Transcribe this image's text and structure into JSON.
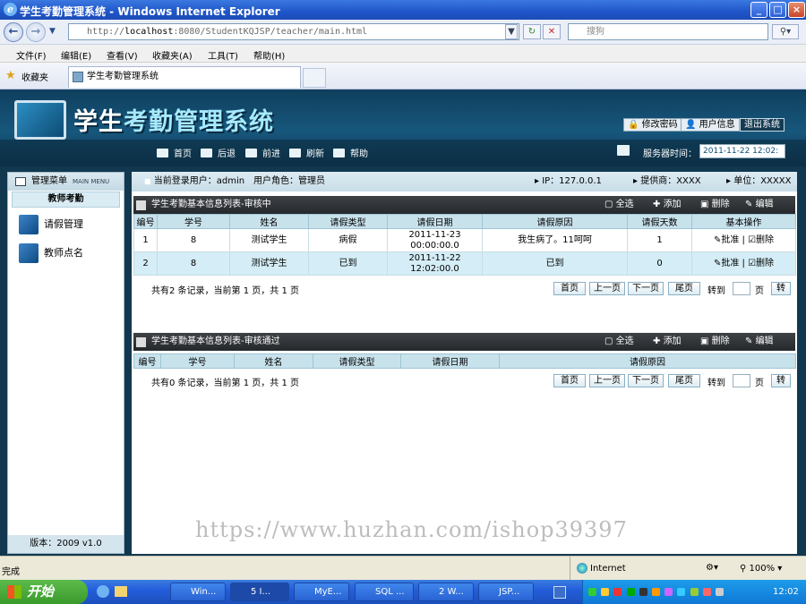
{
  "window": {
    "title": "学生考勤管理系统 - Windows Internet Explorer",
    "min": "_",
    "max": "□",
    "close": "×"
  },
  "address": {
    "scheme": "http://",
    "host": "localhost",
    "path": ":8080/StudentKQJSP/teacher/main.html",
    "search_placeholder": "搜狗"
  },
  "menubar": [
    "文件(F)",
    "编辑(E)",
    "查看(V)",
    "收藏夹(A)",
    "工具(T)",
    "帮助(H)"
  ],
  "favorites": {
    "label": "收藏夹",
    "tab": "学生考勤管理系统"
  },
  "app": {
    "title_a": "学生",
    "title_b": "考勤管理系统",
    "top_buttons": {
      "change_password": "修改密码",
      "user_info": "用户信息",
      "logout": "退出系统"
    },
    "nav": {
      "home": "首页",
      "back": "后退",
      "forward": "前进",
      "refresh": "刷新",
      "help": "帮助"
    },
    "server_time_label": "服务器时间：",
    "server_time": "2011-11-22 12:02:"
  },
  "sidebar": {
    "header": "管理菜单",
    "header_en": "MAIN MENU",
    "section": "教师考勤",
    "items": [
      {
        "label": "请假管理",
        "icon": "leave-icon"
      },
      {
        "label": "教师点名",
        "icon": "rollcall-icon"
      }
    ],
    "version": "版本：2009 v1.0"
  },
  "info": {
    "login_user": "当前登录用户：admin",
    "role": "用户角色：管理员",
    "ip": "IP：127.0.0.1",
    "provider": "提供商：XXXX",
    "unit": "单位：XXXXX"
  },
  "panel1": {
    "title": "学生考勤基本信息列表-审核中",
    "actions": {
      "select_all": "全选",
      "add": "添加",
      "delete": "删除",
      "edit": "编辑"
    },
    "columns": [
      "编号",
      "学号",
      "姓名",
      "请假类型",
      "请假日期",
      "请假原因",
      "请假天数",
      "基本操作"
    ],
    "rows": [
      {
        "id": "1",
        "sno": "8",
        "name": "测试学生",
        "type": "病假",
        "date1": "2011-11-23",
        "date2": "00:00:00.0",
        "reason": "我生病了。11呵呵",
        "days": "1",
        "approve": "批准",
        "del": "删除"
      },
      {
        "id": "2",
        "sno": "8",
        "name": "测试学生",
        "type": "已到",
        "date1": "2011-11-22",
        "date2": "12:02:00.0",
        "reason": "已到",
        "days": "0",
        "approve": "批准",
        "del": "删除"
      }
    ],
    "pager": {
      "summary": "共有2 条记录，当前第  1 页，共 1 页",
      "first": "首页",
      "prev": "上一页",
      "next": "下一页",
      "last": "尾页",
      "goto": "转到",
      "page": "页",
      "go": "转"
    }
  },
  "panel2": {
    "title": "学生考勤基本信息列表-审核通过",
    "actions": {
      "select_all": "全选",
      "add": "添加",
      "delete": "删除",
      "edit": "编辑"
    },
    "columns": [
      "编号",
      "学号",
      "姓名",
      "请假类型",
      "请假日期",
      "请假原因"
    ],
    "pager": {
      "summary": "共有0 条记录，当前第  1 页，共 1 页",
      "first": "首页",
      "prev": "上一页",
      "next": "下一页",
      "last": "尾页",
      "goto": "转到",
      "page": "页",
      "go": "转"
    }
  },
  "watermark": "https://www.huzhan.com/ishop39397",
  "status": {
    "left": "完成",
    "zone": "Internet",
    "zoom": "100%"
  },
  "taskbar": {
    "start": "开始",
    "tasks": [
      "Win...",
      "5 I...",
      "MyE...",
      "SQL ...",
      "2 W...",
      "JSP..."
    ],
    "clock": "12:02"
  }
}
